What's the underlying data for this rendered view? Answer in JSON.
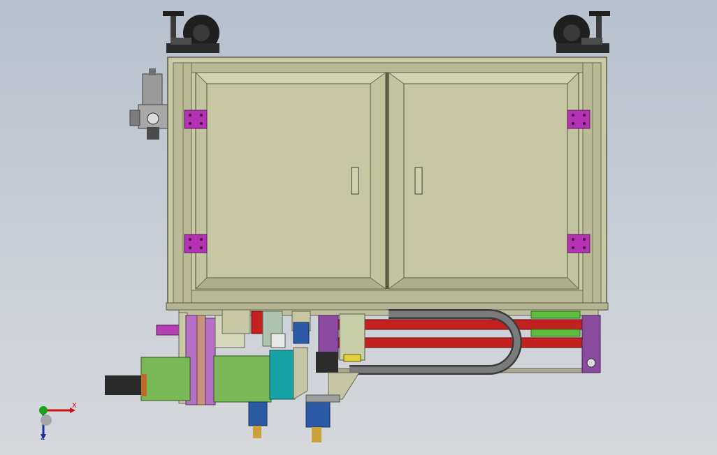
{
  "viewport": {
    "kind": "3D CAD model view",
    "background_top": "#b7c0cd",
    "background_bottom": "#d6d8dc"
  },
  "colors": {
    "frame": "#c9c9a6",
    "frame_dark": "#7c7c5f",
    "door_panel": "#c7c8a3",
    "hinge": "#b532b5",
    "roller_red": "#c42020",
    "bracket_purple": "#8a4a9e",
    "plate_green": "#79b957",
    "teal_block": "#17a3a6",
    "cable_carrier": "#5b5b5b",
    "rail_green": "#5cbf3c",
    "caster_black": "#1e1e1e"
  },
  "triad": {
    "x_label": "X",
    "z_label": "Z",
    "x_color": "#cc1111",
    "y_color": "#18a018",
    "z_color": "#1a2c9a"
  }
}
